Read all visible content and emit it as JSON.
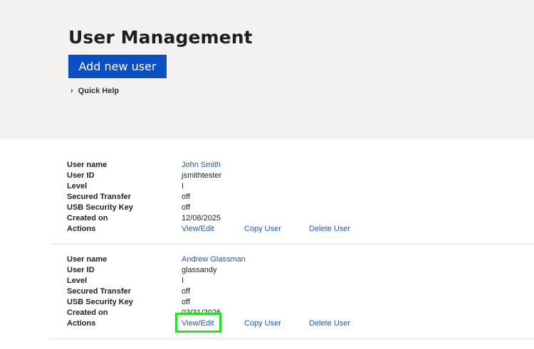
{
  "header": {
    "title": "User Management",
    "add_button": "Add new user",
    "quick_help": "Quick Help",
    "quick_help_icon": "chevron-right-icon"
  },
  "labels": {
    "user_name": "User name",
    "user_id": "User ID",
    "level": "Level",
    "secured_transfer": "Secured Transfer",
    "usb_key": "USB Security Key",
    "created_on": "Created on",
    "actions": "Actions"
  },
  "users": [
    {
      "user_name": "John Smith",
      "user_id": "jsmithtester",
      "level": "I",
      "secured_transfer": "off",
      "usb_key": "off",
      "created_on": "12/08/2025",
      "view_edit": "View/Edit",
      "copy": "Copy User",
      "delete": "Delete User"
    },
    {
      "user_name": "Andrew Glassman",
      "user_id": "glassandy",
      "level": "I",
      "secured_transfer": "off",
      "usb_key": "off",
      "created_on": "03/31/2026",
      "view_edit": "View/Edit",
      "copy": "Copy User",
      "delete": "Delete User"
    }
  ],
  "colors": {
    "accent": "#0a4fc4",
    "link": "#1a56c4",
    "header_bg": "#f3f2f1",
    "highlight": "#22e522"
  }
}
